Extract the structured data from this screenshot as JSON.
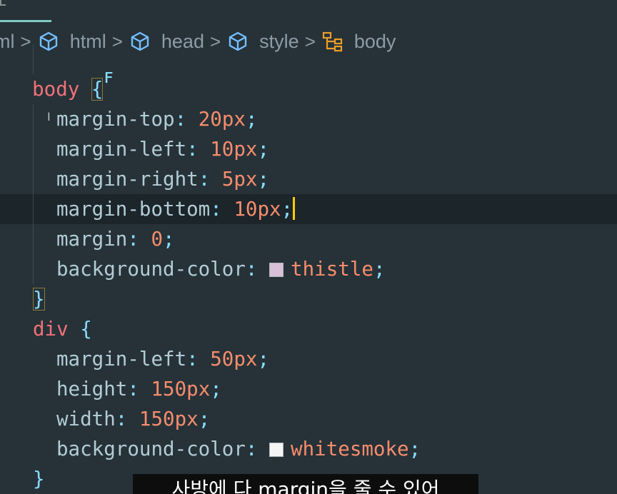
{
  "breadcrumb": {
    "items": [
      {
        "label": "ml",
        "icon": "none"
      },
      {
        "label": "html",
        "icon": "cube-icon"
      },
      {
        "label": "head",
        "icon": "cube-icon"
      },
      {
        "label": "style",
        "icon": "cube-icon"
      },
      {
        "label": "body",
        "icon": "symbol-structure-icon"
      }
    ],
    "separator": ">"
  },
  "code": {
    "line0": "ꜰ",
    "body_rule": {
      "selector": "body",
      "open_brace": "{",
      "close_brace": "}",
      "declarations": [
        {
          "property": "margin-top",
          "value": "20px"
        },
        {
          "property": "margin-left",
          "value": "10px"
        },
        {
          "property": "margin-right",
          "value": "5px"
        },
        {
          "property": "margin-bottom",
          "value": "10px"
        },
        {
          "property": "margin",
          "value": "0"
        },
        {
          "property": "background-color",
          "value": "thistle",
          "swatch": "#d8bfd8"
        }
      ]
    },
    "div_rule": {
      "selector": "div",
      "open_brace": "{",
      "close_brace": "}",
      "declarations": [
        {
          "property": "margin-left",
          "value": "50px"
        },
        {
          "property": "height",
          "value": "150px"
        },
        {
          "property": "width",
          "value": "150px"
        },
        {
          "property": "background-color",
          "value": "whitesmoke",
          "swatch": "#f5f5f5"
        }
      ]
    },
    "colon": ":",
    "semicolon": ";"
  },
  "subtitle": {
    "text": "사방에 다 margin을 줄 수 있어"
  },
  "colors": {
    "background": "#263238",
    "selector": "#f07178",
    "number": "#f78c6c",
    "punctuation": "#89ddff",
    "caret": "#ffcc00"
  }
}
